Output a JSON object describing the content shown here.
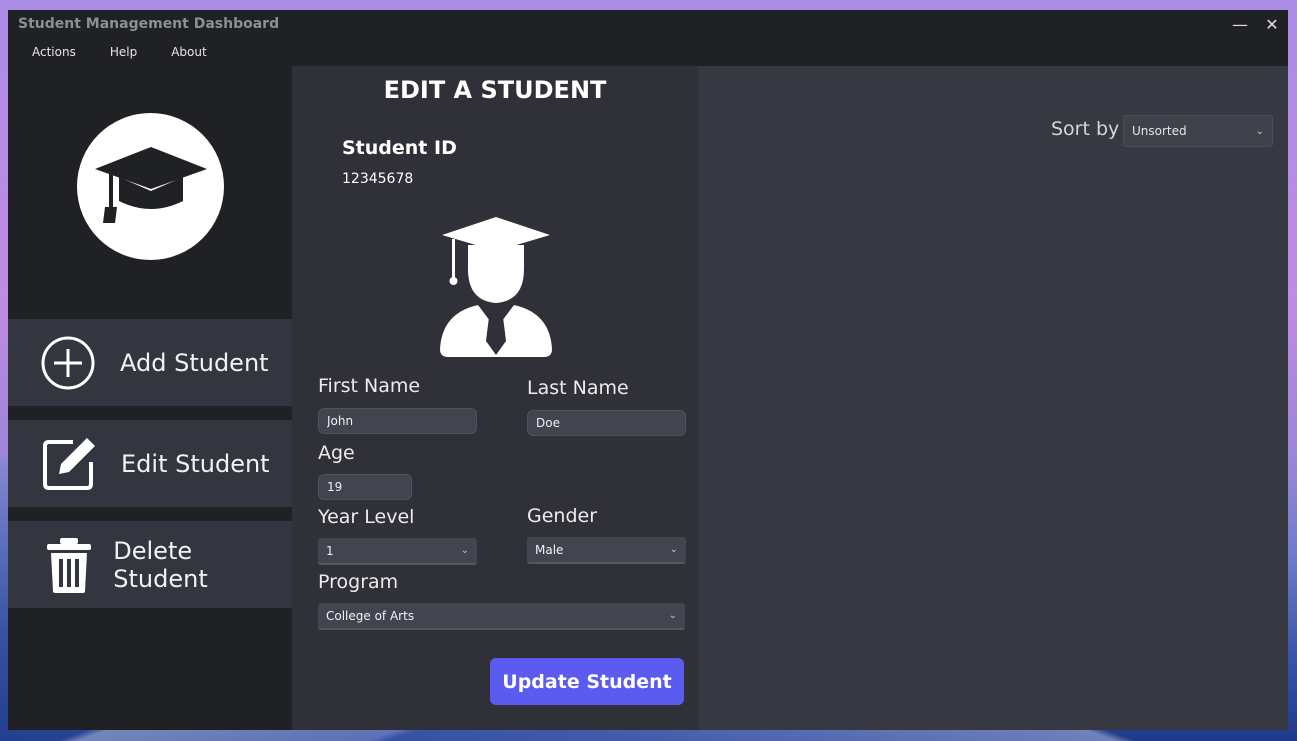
{
  "window": {
    "title": "Student Management Dashboard",
    "minimize": "—",
    "close": "✕"
  },
  "menu": {
    "items": [
      "Actions",
      "Help",
      "About"
    ]
  },
  "sidebar": {
    "logo_icon": "graduation-cap-icon",
    "nav": [
      {
        "label": "Add Student",
        "icon": "plus-circle-icon"
      },
      {
        "label": "Edit Student",
        "icon": "edit-icon"
      },
      {
        "label": "Delete Student",
        "icon": "trash-icon"
      }
    ]
  },
  "form": {
    "title": "EDIT A STUDENT",
    "student_id_label": "Student ID",
    "student_id_value": "12345678",
    "avatar_icon": "student-avatar-icon",
    "first_name_label": "First Name",
    "first_name_value": "John",
    "last_name_label": "Last Name",
    "last_name_value": "Doe",
    "age_label": "Age",
    "age_value": "19",
    "year_level_label": "Year Level",
    "year_level_value": "1",
    "gender_label": "Gender",
    "gender_value": "Male",
    "program_label": "Program",
    "program_value": "College of Arts",
    "submit_label": "Update Student"
  },
  "list": {
    "sort_label": "Sort by",
    "sort_value": "Unsorted"
  },
  "colors": {
    "accent": "#5b5bf0",
    "sidebar_bg": "#202124",
    "nav_bg": "#34363f",
    "form_bg": "#2f3038",
    "right_bg": "#363842"
  }
}
